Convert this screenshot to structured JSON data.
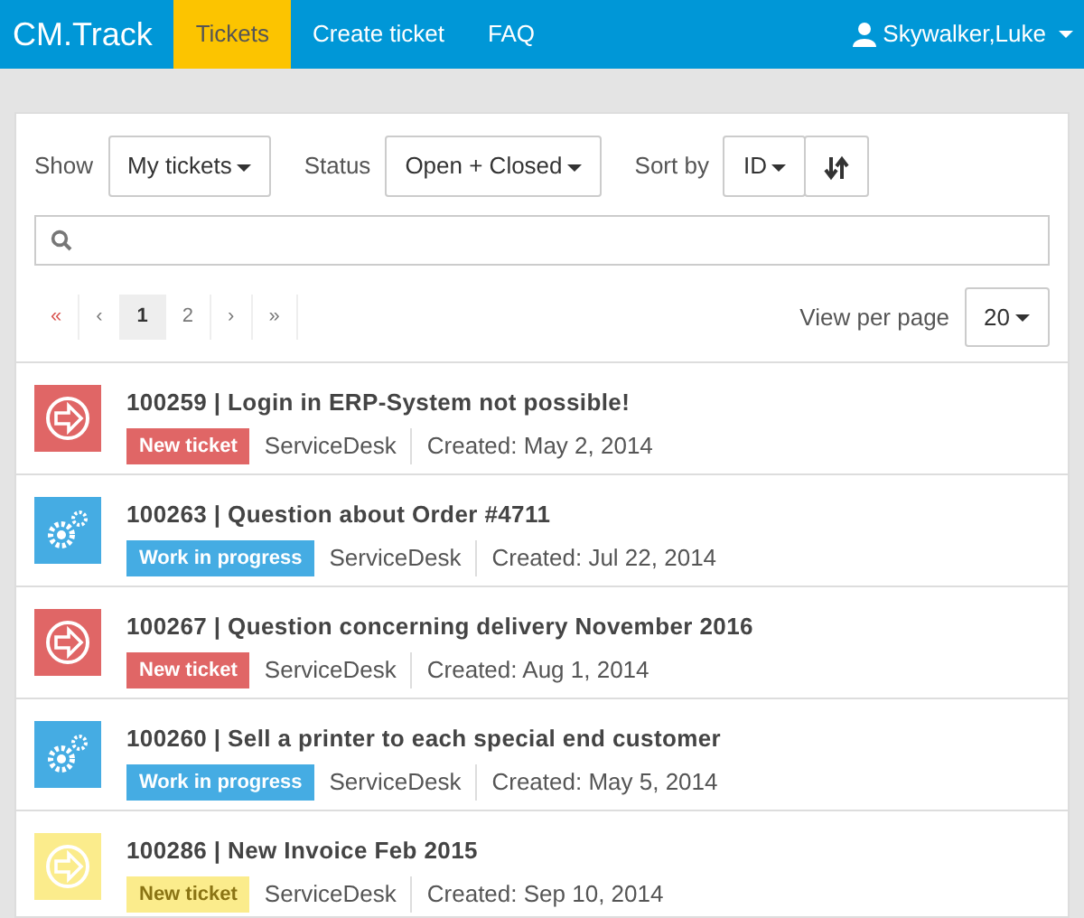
{
  "navbar": {
    "brand": "CM.Track",
    "tabs": [
      {
        "label": "Tickets",
        "selected": true
      },
      {
        "label": "Create ticket",
        "selected": false
      },
      {
        "label": "FAQ",
        "selected": false
      }
    ],
    "user": "Skywalker,Luke"
  },
  "filters": [
    {
      "label": "Show",
      "value": "My tickets"
    },
    {
      "label": "Status",
      "value": "Open + Closed"
    }
  ],
  "sort": {
    "label": "Sort by",
    "value": "ID"
  },
  "pagination": [
    {
      "text": "«",
      "selected": false
    },
    {
      "text": "‹",
      "selected": false
    },
    {
      "text": "1",
      "selected": true
    },
    {
      "text": "2",
      "selected": false
    },
    {
      "text": "›",
      "selected": false
    },
    {
      "text": "»",
      "selected": false
    }
  ],
  "per_page": {
    "label": "View per page",
    "value": "20"
  },
  "tickets": [
    {
      "title": "100259 | Login in ERP-System not possible!",
      "kind": "new",
      "color": "#e06666",
      "status": "New ticket",
      "team": "ServiceDesk",
      "created": "Created: May 2, 2014"
    },
    {
      "title": "100263 | Question about Order #4711",
      "kind": "progress",
      "color": "#45ace3",
      "status": "Work in progress",
      "team": "ServiceDesk",
      "created": "Created: Jul 22, 2014"
    },
    {
      "title": "100267 | Question concerning delivery November 2016",
      "kind": "new",
      "color": "#e06666",
      "status": "New ticket",
      "team": "ServiceDesk",
      "created": "Created: Aug 1, 2014"
    },
    {
      "title": "100260 | Sell a printer to each special end customer",
      "kind": "progress",
      "color": "#45ace3",
      "status": "Work in progress",
      "team": "ServiceDesk",
      "created": "Created: May 5, 2014"
    },
    {
      "title": "100286 | New Invoice Feb 2015",
      "kind": "new",
      "color": "#fbec8c",
      "status": "New ticket",
      "team": "ServiceDesk",
      "created": "Created: Sep 10, 2014"
    }
  ]
}
